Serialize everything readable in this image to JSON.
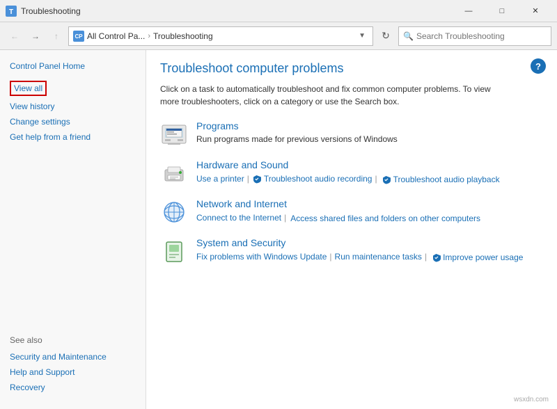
{
  "titlebar": {
    "title": "Troubleshooting",
    "min_label": "—",
    "max_label": "□",
    "close_label": "✕"
  },
  "addressbar": {
    "breadcrumb_icon": "CP",
    "breadcrumb_part1": "All Control Pa...",
    "breadcrumb_sep": "›",
    "breadcrumb_current": "Troubleshooting",
    "search_placeholder": "Search Troubleshooting"
  },
  "sidebar": {
    "home_label": "Control Panel Home",
    "view_all_label": "View all",
    "view_history_label": "View history",
    "change_settings_label": "Change settings",
    "get_help_label": "Get help from a friend",
    "see_also_title": "See also",
    "see_also_items": [
      "Security and Maintenance",
      "Help and Support",
      "Recovery"
    ]
  },
  "content": {
    "title": "Troubleshoot computer problems",
    "description": "Click on a task to automatically troubleshoot and fix common computer problems. To view more troubleshooters, click on a category or use the Search box.",
    "help_label": "?",
    "categories": [
      {
        "id": "programs",
        "title": "Programs",
        "subtitle": "Run programs made for previous versions of Windows",
        "links": []
      },
      {
        "id": "hardware-sound",
        "title": "Hardware and Sound",
        "subtitle": "",
        "links": [
          {
            "label": "Use a printer",
            "has_shield": false
          },
          {
            "label": "Troubleshoot audio recording",
            "has_shield": true
          },
          {
            "label": "Troubleshoot audio playback",
            "has_shield": true
          }
        ]
      },
      {
        "id": "network-internet",
        "title": "Network and Internet",
        "subtitle": "",
        "links": [
          {
            "label": "Connect to the Internet",
            "has_shield": false
          },
          {
            "label": "Access shared files and folders on other computers",
            "has_shield": false
          }
        ]
      },
      {
        "id": "system-security",
        "title": "System and Security",
        "subtitle": "",
        "links": [
          {
            "label": "Fix problems with Windows Update",
            "has_shield": false
          },
          {
            "label": "Run maintenance tasks",
            "has_shield": false
          },
          {
            "label": "Improve power usage",
            "has_shield": true
          }
        ]
      }
    ]
  },
  "watermark": "wsxdn.com"
}
